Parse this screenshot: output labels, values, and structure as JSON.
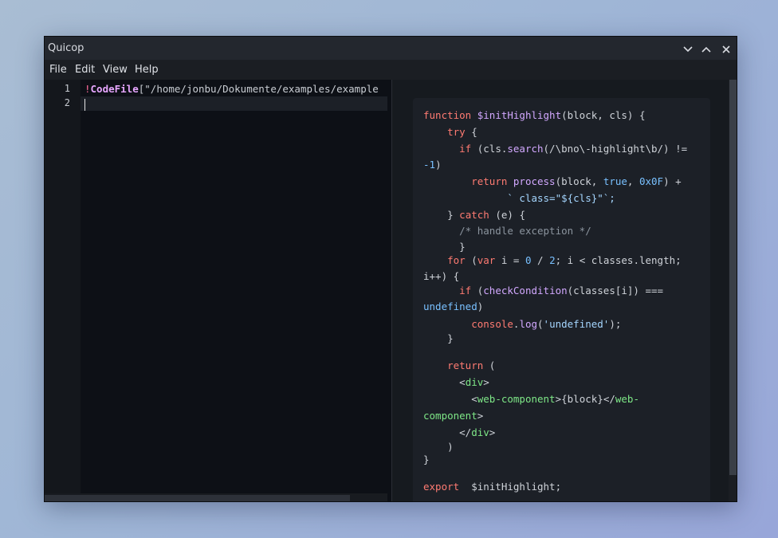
{
  "window": {
    "title": "Quicop"
  },
  "menubar": {
    "items": [
      "File",
      "Edit",
      "View",
      "Help"
    ]
  },
  "editor": {
    "line_numbers": [
      "1",
      "2"
    ],
    "line1": {
      "bang": "!",
      "command": "CodeFile",
      "rest": "[\"/home/jonbu/Dokumente/examples/example"
    }
  },
  "preview": {
    "t": {
      "function": "function",
      "name": "$initHighlight",
      "sig": "(block, cls) {",
      "try": "try",
      "brace": " {",
      "if": "if",
      "cls_dot": " (cls.",
      "search": "search",
      "regex": "(/\\bno\\-highlight\\b/) !=",
      "neg1": "-1",
      "paren_close": ")",
      "return": "return",
      "process": "process",
      "block_args": "(block, ",
      "true": "true",
      "comma": ", ",
      "hex": "0x0F",
      "plus": ") +",
      "template": "` class=\"${cls}\"`;",
      "catch_pre": "} ",
      "catch": "catch",
      "catch_args": " (e) {",
      "comment": "/* handle exception */",
      "close": "}",
      "for": "for",
      "open_paren": " (",
      "var": "var",
      "i_eq": " i = ",
      "zero": "0",
      "slash": " / ",
      "two": "2",
      "cond": "; i < classes.length;",
      "incr": "i++) {",
      "check": "checkCondition",
      "check_args": "(classes[i]) ===",
      "undefined": "undefined",
      "console": "console",
      "dot": ".",
      "log": "log",
      "log_open": "(",
      "str_undef": "'undefined'",
      "log_close": ");",
      "return_open": " (",
      "lt": "<",
      "div": "div",
      "gt": ">",
      "wc": "web-component",
      "block_expr": "{block}",
      "lt_slash": "</",
      "wc_part1": "web-",
      "wc_part2": "component",
      "rparen": ")",
      "export": "export",
      "export_name": "  $initHighlight;"
    }
  }
}
